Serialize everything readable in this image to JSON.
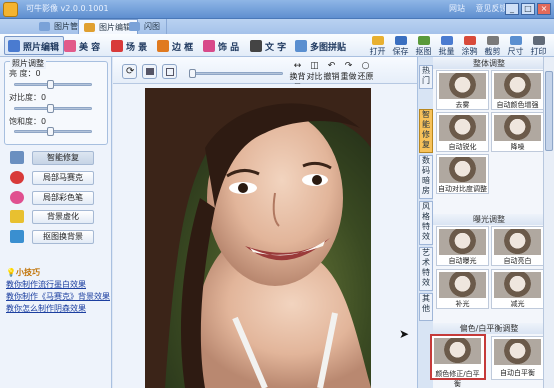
{
  "window": {
    "title": "可牛影像  v2.0.0.1001",
    "links": [
      "网站",
      "意见反馈"
    ],
    "controls": [
      "_",
      "□",
      "×"
    ]
  },
  "nav_tabs": [
    {
      "label": "图片管理",
      "active": false
    },
    {
      "label": "图片编辑",
      "active": true
    },
    {
      "label": "闪图",
      "active": false
    }
  ],
  "toolbar": {
    "left_items": [
      {
        "label": "照片编辑",
        "icon": "photo-edit-icon",
        "color": "#4a7bd0",
        "active": true
      },
      {
        "label": "美 容",
        "icon": "beauty-icon",
        "color": "#e25a8a",
        "active": false
      },
      {
        "label": "场 景",
        "icon": "scene-icon",
        "color": "#d83a3a",
        "active": false
      },
      {
        "label": "边 框",
        "icon": "frame-icon",
        "color": "#e07a20",
        "active": false
      },
      {
        "label": "饰 品",
        "icon": "accessory-icon",
        "color": "#d84a8a",
        "active": false
      },
      {
        "label": "文 字",
        "icon": "text-icon",
        "color": "#444444",
        "active": false
      },
      {
        "label": "多图拼贴",
        "icon": "collage-icon",
        "color": "#5a8fd0",
        "active": false
      }
    ],
    "right_items": [
      {
        "label": "打开",
        "icon": "open-icon",
        "color": "#e8b030"
      },
      {
        "label": "保存",
        "icon": "save-icon",
        "color": "#3a6fc0"
      },
      {
        "label": "抠图",
        "icon": "cutout-icon",
        "color": "#5a9a3a"
      },
      {
        "label": "批量",
        "icon": "batch-icon",
        "color": "#4a7bd0"
      },
      {
        "label": "涂鸦",
        "icon": "doodle-icon",
        "color": "#d84a3a"
      },
      {
        "label": "截剪",
        "icon": "crop-icon",
        "color": "#7a7a7a"
      },
      {
        "label": "尺寸",
        "icon": "size-icon",
        "color": "#5a8fd0"
      },
      {
        "label": "打印",
        "icon": "print-icon",
        "color": "#606a78"
      }
    ]
  },
  "photo_adjust": {
    "title": "照片调整",
    "sliders": [
      {
        "label": "亮 度：",
        "value": "0"
      },
      {
        "label": "对比度：",
        "value": "0"
      },
      {
        "label": "饱和度：",
        "value": "0"
      }
    ]
  },
  "left_buttons": [
    {
      "label": "智能修复",
      "icon": "repair-icon",
      "color": "#6a8fc0",
      "active": true
    },
    {
      "label": "局部马赛克",
      "icon": "mosaic-icon",
      "color": "#d83a3a",
      "active": false
    },
    {
      "label": "局部彩色笔",
      "icon": "color-pen-icon",
      "color": "#e05090",
      "active": false
    },
    {
      "label": "背景虚化",
      "icon": "blur-icon",
      "color": "#e8c030",
      "active": false
    },
    {
      "label": "抠图换背景",
      "icon": "bg-swap-icon",
      "color": "#3a8fd0",
      "active": false
    }
  ],
  "tips": {
    "title": "小技巧",
    "links": [
      "教你制作流行墨白效果",
      "教你制作《马赛克》背景效果",
      "教你怎么制作阴森效果"
    ]
  },
  "canvas_toolbar": {
    "tools": [
      {
        "label": "换背景",
        "glyph": "↔"
      },
      {
        "label": "对比",
        "glyph": "◫"
      },
      {
        "label": "撤销",
        "glyph": "↶"
      },
      {
        "label": "重做",
        "glyph": "↷"
      },
      {
        "label": "还原",
        "glyph": "○"
      }
    ]
  },
  "vertical_tabs": [
    {
      "label": "热门",
      "active": false
    },
    {
      "label": "智能修复",
      "active": true
    },
    {
      "label": "数码暗房",
      "active": false
    },
    {
      "label": "风格特效",
      "active": false
    },
    {
      "label": "艺术特效",
      "active": false
    },
    {
      "label": "其他",
      "active": false
    }
  ],
  "effect_sections": [
    {
      "title": "整体调整",
      "items": [
        {
          "label": "去雾",
          "selected": false
        },
        {
          "label": "自动颜色增强",
          "selected": false
        },
        {
          "label": "自动锐化",
          "selected": false
        },
        {
          "label": "降噪",
          "selected": false
        },
        {
          "label": "自动对比度调整",
          "selected": false
        }
      ]
    },
    {
      "title": "曝光调整",
      "items": [
        {
          "label": "自动曝光",
          "selected": false
        },
        {
          "label": "自动亮白",
          "selected": false
        },
        {
          "label": "补光",
          "selected": false
        },
        {
          "label": "减光",
          "selected": false
        }
      ]
    },
    {
      "title": "偏色/白平衡调整",
      "items": [
        {
          "label": "颜色修正/白平衡",
          "selected": true
        },
        {
          "label": "自动白平衡",
          "selected": false
        }
      ]
    }
  ]
}
